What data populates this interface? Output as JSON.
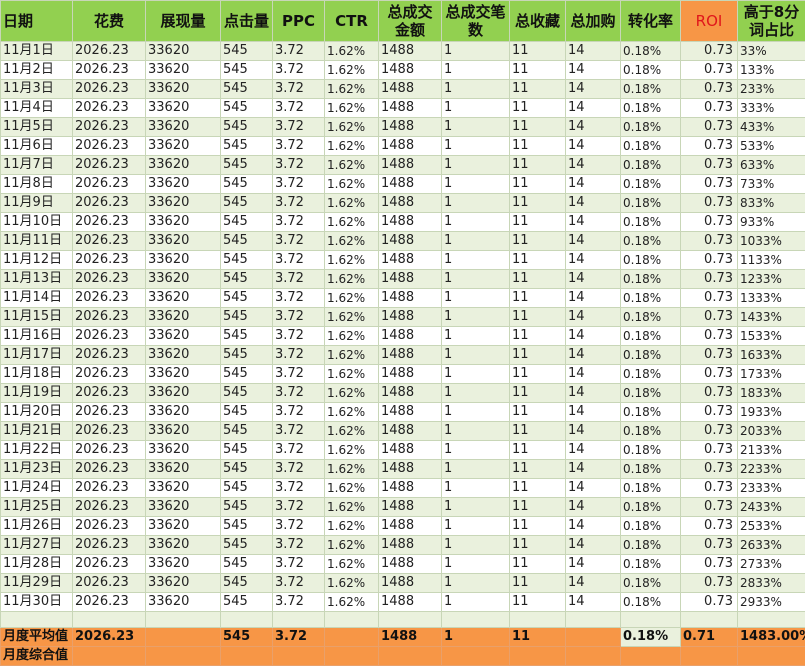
{
  "headers": [
    {
      "key": "date",
      "label": "日期"
    },
    {
      "key": "spend",
      "label": "花费"
    },
    {
      "key": "impressions",
      "label": "展现量"
    },
    {
      "key": "clicks",
      "label": "点击量"
    },
    {
      "key": "ppc",
      "label": "PPC"
    },
    {
      "key": "ctr",
      "label": "CTR"
    },
    {
      "key": "gmv",
      "label": "总成交金额"
    },
    {
      "key": "orders",
      "label": "总成交笔数"
    },
    {
      "key": "favorites",
      "label": "总收藏"
    },
    {
      "key": "carts",
      "label": "总加购"
    },
    {
      "key": "cvr",
      "label": "转化率"
    },
    {
      "key": "roi",
      "label": "ROI"
    },
    {
      "key": "ratio",
      "label": "高于8分词占比"
    }
  ],
  "rows": [
    [
      "11月1日",
      "2026.23",
      "33620",
      "545",
      "3.72",
      "1.62%",
      "1488",
      "1",
      "11",
      "14",
      "0.18%",
      "0.73",
      "33%"
    ],
    [
      "11月2日",
      "2026.23",
      "33620",
      "545",
      "3.72",
      "1.62%",
      "1488",
      "1",
      "11",
      "14",
      "0.18%",
      "0.73",
      "133%"
    ],
    [
      "11月3日",
      "2026.23",
      "33620",
      "545",
      "3.72",
      "1.62%",
      "1488",
      "1",
      "11",
      "14",
      "0.18%",
      "0.73",
      "233%"
    ],
    [
      "11月4日",
      "2026.23",
      "33620",
      "545",
      "3.72",
      "1.62%",
      "1488",
      "1",
      "11",
      "14",
      "0.18%",
      "0.73",
      "333%"
    ],
    [
      "11月5日",
      "2026.23",
      "33620",
      "545",
      "3.72",
      "1.62%",
      "1488",
      "1",
      "11",
      "14",
      "0.18%",
      "0.73",
      "433%"
    ],
    [
      "11月6日",
      "2026.23",
      "33620",
      "545",
      "3.72",
      "1.62%",
      "1488",
      "1",
      "11",
      "14",
      "0.18%",
      "0.73",
      "533%"
    ],
    [
      "11月7日",
      "2026.23",
      "33620",
      "545",
      "3.72",
      "1.62%",
      "1488",
      "1",
      "11",
      "14",
      "0.18%",
      "0.73",
      "633%"
    ],
    [
      "11月8日",
      "2026.23",
      "33620",
      "545",
      "3.72",
      "1.62%",
      "1488",
      "1",
      "11",
      "14",
      "0.18%",
      "0.73",
      "733%"
    ],
    [
      "11月9日",
      "2026.23",
      "33620",
      "545",
      "3.72",
      "1.62%",
      "1488",
      "1",
      "11",
      "14",
      "0.18%",
      "0.73",
      "833%"
    ],
    [
      "11月10日",
      "2026.23",
      "33620",
      "545",
      "3.72",
      "1.62%",
      "1488",
      "1",
      "11",
      "14",
      "0.18%",
      "0.73",
      "933%"
    ],
    [
      "11月11日",
      "2026.23",
      "33620",
      "545",
      "3.72",
      "1.62%",
      "1488",
      "1",
      "11",
      "14",
      "0.18%",
      "0.73",
      "1033%"
    ],
    [
      "11月12日",
      "2026.23",
      "33620",
      "545",
      "3.72",
      "1.62%",
      "1488",
      "1",
      "11",
      "14",
      "0.18%",
      "0.73",
      "1133%"
    ],
    [
      "11月13日",
      "2026.23",
      "33620",
      "545",
      "3.72",
      "1.62%",
      "1488",
      "1",
      "11",
      "14",
      "0.18%",
      "0.73",
      "1233%"
    ],
    [
      "11月14日",
      "2026.23",
      "33620",
      "545",
      "3.72",
      "1.62%",
      "1488",
      "1",
      "11",
      "14",
      "0.18%",
      "0.73",
      "1333%"
    ],
    [
      "11月15日",
      "2026.23",
      "33620",
      "545",
      "3.72",
      "1.62%",
      "1488",
      "1",
      "11",
      "14",
      "0.18%",
      "0.73",
      "1433%"
    ],
    [
      "11月16日",
      "2026.23",
      "33620",
      "545",
      "3.72",
      "1.62%",
      "1488",
      "1",
      "11",
      "14",
      "0.18%",
      "0.73",
      "1533%"
    ],
    [
      "11月17日",
      "2026.23",
      "33620",
      "545",
      "3.72",
      "1.62%",
      "1488",
      "1",
      "11",
      "14",
      "0.18%",
      "0.73",
      "1633%"
    ],
    [
      "11月18日",
      "2026.23",
      "33620",
      "545",
      "3.72",
      "1.62%",
      "1488",
      "1",
      "11",
      "14",
      "0.18%",
      "0.73",
      "1733%"
    ],
    [
      "11月19日",
      "2026.23",
      "33620",
      "545",
      "3.72",
      "1.62%",
      "1488",
      "1",
      "11",
      "14",
      "0.18%",
      "0.73",
      "1833%"
    ],
    [
      "11月20日",
      "2026.23",
      "33620",
      "545",
      "3.72",
      "1.62%",
      "1488",
      "1",
      "11",
      "14",
      "0.18%",
      "0.73",
      "1933%"
    ],
    [
      "11月21日",
      "2026.23",
      "33620",
      "545",
      "3.72",
      "1.62%",
      "1488",
      "1",
      "11",
      "14",
      "0.18%",
      "0.73",
      "2033%"
    ],
    [
      "11月22日",
      "2026.23",
      "33620",
      "545",
      "3.72",
      "1.62%",
      "1488",
      "1",
      "11",
      "14",
      "0.18%",
      "0.73",
      "2133%"
    ],
    [
      "11月23日",
      "2026.23",
      "33620",
      "545",
      "3.72",
      "1.62%",
      "1488",
      "1",
      "11",
      "14",
      "0.18%",
      "0.73",
      "2233%"
    ],
    [
      "11月24日",
      "2026.23",
      "33620",
      "545",
      "3.72",
      "1.62%",
      "1488",
      "1",
      "11",
      "14",
      "0.18%",
      "0.73",
      "2333%"
    ],
    [
      "11月25日",
      "2026.23",
      "33620",
      "545",
      "3.72",
      "1.62%",
      "1488",
      "1",
      "11",
      "14",
      "0.18%",
      "0.73",
      "2433%"
    ],
    [
      "11月26日",
      "2026.23",
      "33620",
      "545",
      "3.72",
      "1.62%",
      "1488",
      "1",
      "11",
      "14",
      "0.18%",
      "0.73",
      "2533%"
    ],
    [
      "11月27日",
      "2026.23",
      "33620",
      "545",
      "3.72",
      "1.62%",
      "1488",
      "1",
      "11",
      "14",
      "0.18%",
      "0.73",
      "2633%"
    ],
    [
      "11月28日",
      "2026.23",
      "33620",
      "545",
      "3.72",
      "1.62%",
      "1488",
      "1",
      "11",
      "14",
      "0.18%",
      "0.73",
      "2733%"
    ],
    [
      "11月29日",
      "2026.23",
      "33620",
      "545",
      "3.72",
      "1.62%",
      "1488",
      "1",
      "11",
      "14",
      "0.18%",
      "0.73",
      "2833%"
    ],
    [
      "11月30日",
      "2026.23",
      "33620",
      "545",
      "3.72",
      "1.62%",
      "1488",
      "1",
      "11",
      "14",
      "0.18%",
      "0.73",
      "2933%"
    ]
  ],
  "summary": {
    "label": "月度平均值",
    "values": [
      "2026.23",
      "",
      "545",
      "3.72",
      "",
      "1488",
      "1",
      "11",
      "",
      "0.18%",
      "0.71",
      "1483.00%"
    ]
  },
  "composite": {
    "label": "月度综合值"
  },
  "colors": {
    "header_bg": "#92d050",
    "roi_header_bg": "#f79646",
    "roi_header_text": "#e0161b",
    "band_light": "#eaf1dd",
    "summary_bg": "#f79646"
  }
}
